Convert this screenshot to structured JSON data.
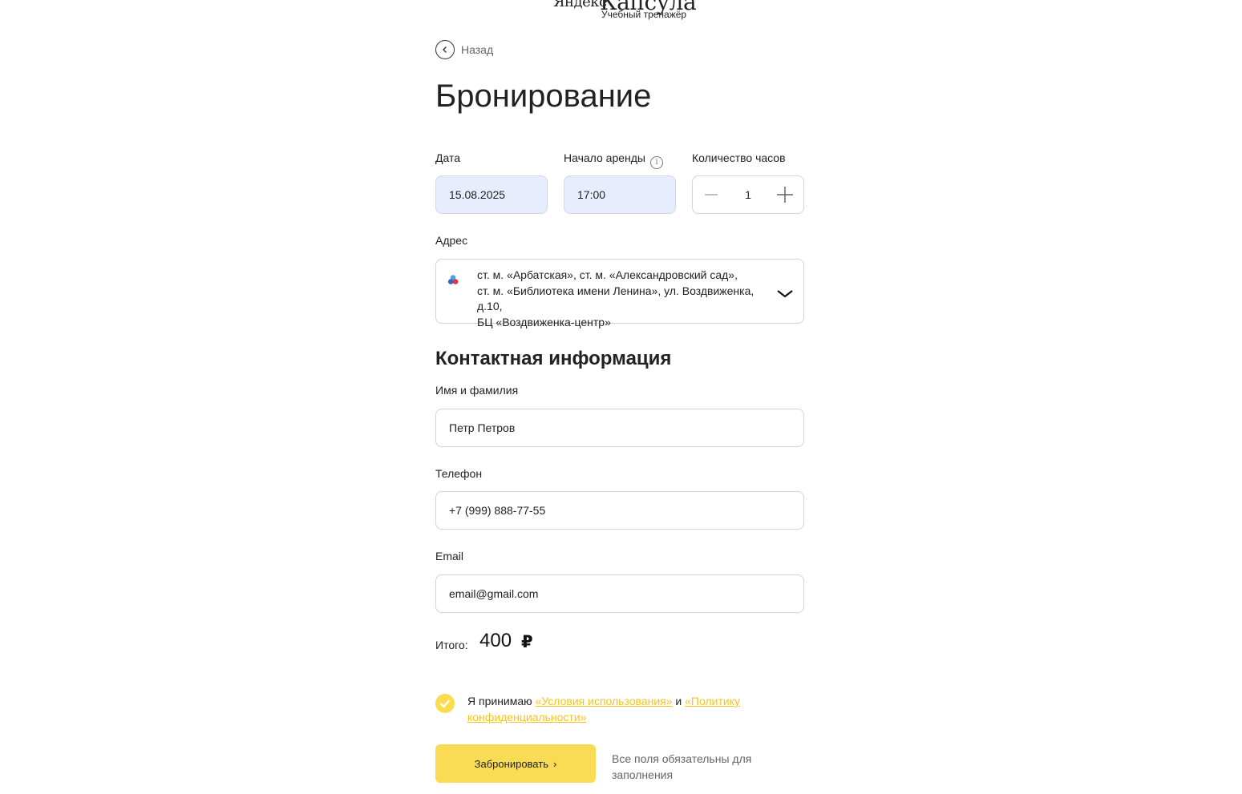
{
  "logo": {
    "brand_small": "Яндекс",
    "brand_large": "Капсула",
    "subtitle": "Учебный тренажёр"
  },
  "back_label": "Назад",
  "title": "Бронирование",
  "date": {
    "label": "Дата",
    "value": "15.08.2025"
  },
  "start": {
    "label": "Начало аренды",
    "value": "17:00",
    "info_icon": "i"
  },
  "hours": {
    "label": "Количество часов",
    "value": "1"
  },
  "address": {
    "label": "Адрес",
    "line1": "ст. м. «Арбатская», ст. м. «Александровский сад»,",
    "line2": "ст. м. «Библиотека имени Ленина», ул. Воздвиженка, д.10,",
    "line3": "БЦ «Воздвиженка-центр»"
  },
  "contact": {
    "section_title": "Контактная информация",
    "name_label": "Имя и фамилия",
    "name_value": "Петр Петров",
    "phone_label": "Телефон",
    "phone_value": "+7 (999) 888-77-55",
    "email_label": "Email",
    "email_value": "email@gmail.com"
  },
  "total": {
    "label": "Итого:",
    "value": "400",
    "currency": "₽"
  },
  "consent": {
    "prefix": "Я принимаю ",
    "terms_link": "«Условия использования»",
    "middle": " и ",
    "privacy_link": "«Политику конфиденциальности»"
  },
  "submit_label": "Забронировать",
  "submit_arrow": "›",
  "note": "Все поля обязательны для заполнения",
  "colors": {
    "accent": "#f9dc53",
    "link": "#f4c41e",
    "filled_input": "#e8edfd"
  }
}
